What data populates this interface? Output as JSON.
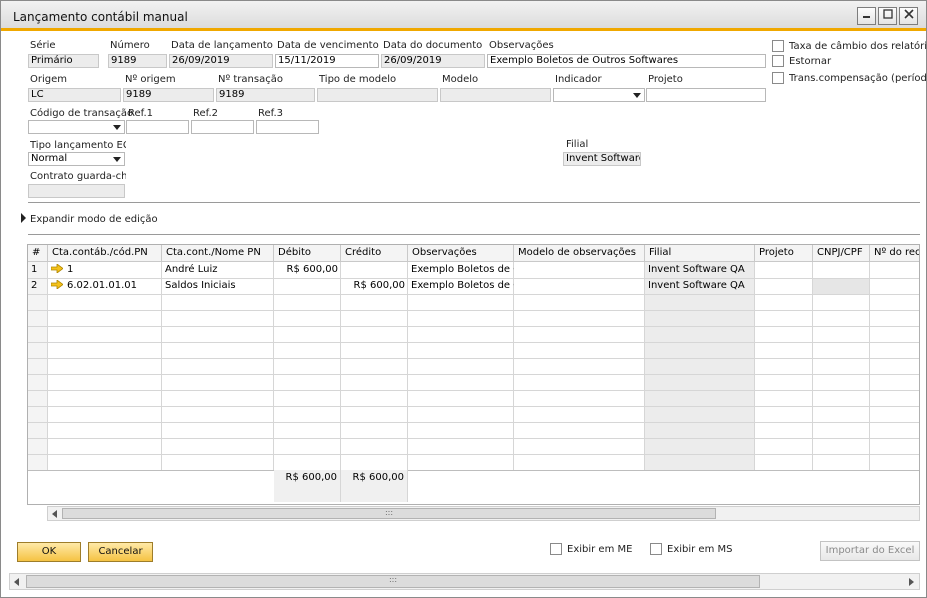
{
  "window": {
    "title": "Lançamento contábil manual"
  },
  "header": {
    "serie": {
      "label": "Série",
      "value": "Primário"
    },
    "numero": {
      "label": "Número",
      "value": "9189"
    },
    "data_lancamento": {
      "label": "Data de lançamento",
      "value": "26/09/2019"
    },
    "data_vencimento": {
      "label": "Data de vencimento",
      "value": "15/11/2019"
    },
    "data_documento": {
      "label": "Data do documento",
      "value": "26/09/2019"
    },
    "observacoes": {
      "label": "Observações",
      "value": "Exemplo Boletos de Outros Softwares"
    },
    "origem": {
      "label": "Origem",
      "value": "LC"
    },
    "n_origem": {
      "label": "Nº origem",
      "value": "9189"
    },
    "n_transacao": {
      "label": "Nº transação",
      "value": "9189"
    },
    "tipo_modelo": {
      "label": "Tipo de modelo",
      "value": ""
    },
    "modelo": {
      "label": "Modelo",
      "value": ""
    },
    "indicador": {
      "label": "Indicador",
      "value": ""
    },
    "projeto": {
      "label": "Projeto",
      "value": ""
    },
    "codigo_transacao": {
      "label": "Código de transação",
      "value": ""
    },
    "ref1": {
      "label": "Ref.1",
      "value": ""
    },
    "ref2": {
      "label": "Ref.2",
      "value": ""
    },
    "ref3": {
      "label": "Ref.3",
      "value": ""
    },
    "tipo_lancamento": {
      "label": "Tipo lançamento ECD",
      "value": "Normal"
    },
    "filial": {
      "label": "Filial",
      "value": "Invent Software"
    },
    "contrato": {
      "label": "Contrato guarda-chuva",
      "value": ""
    }
  },
  "options": {
    "taxa_cambio": {
      "label": "Taxa de câmbio dos relatórios",
      "checked": false
    },
    "estornar": {
      "label": "Estornar",
      "checked": false
    },
    "trans_compensacao": {
      "label": "Trans.compensação (período",
      "checked": false
    }
  },
  "expand_label": "Expandir modo de edição",
  "grid": {
    "columns": [
      "#",
      "Cta.contáb./cód.PN",
      "Cta.cont./Nome PN",
      "Débito",
      "Crédito",
      "Observações",
      "Modelo de observações",
      "Filial",
      "Projeto",
      "CNPJ/CPF",
      "Nº do reci"
    ],
    "rows": [
      {
        "num": "1",
        "conta": "1",
        "nome": "André Luiz",
        "debito": "R$ 600,00",
        "credito": "",
        "obs": "Exemplo Boletos de Ou",
        "modelo_obs": "",
        "filial": "Invent Software QA",
        "projeto": "",
        "cnpj": "",
        "recibo": ""
      },
      {
        "num": "2",
        "conta": "6.02.01.01.01",
        "nome": "Saldos Iniciais",
        "debito": "",
        "credito": "R$ 600,00",
        "obs": "Exemplo Boletos de Ou",
        "modelo_obs": "",
        "filial": "Invent Software QA",
        "projeto": "",
        "cnpj": "",
        "recibo": ""
      }
    ],
    "totals": {
      "debito": "R$ 600,00",
      "credito": "R$ 600,00"
    }
  },
  "footer": {
    "ok_label": "OK",
    "cancel_label": "Cancelar",
    "exibir_me": {
      "label": "Exibir em ME",
      "checked": false
    },
    "exibir_ms": {
      "label": "Exibir em MS",
      "checked": false
    },
    "importar_label": "Importar do Excel"
  },
  "colors": {
    "accent": "#f0a800",
    "button": "#f5c343"
  }
}
